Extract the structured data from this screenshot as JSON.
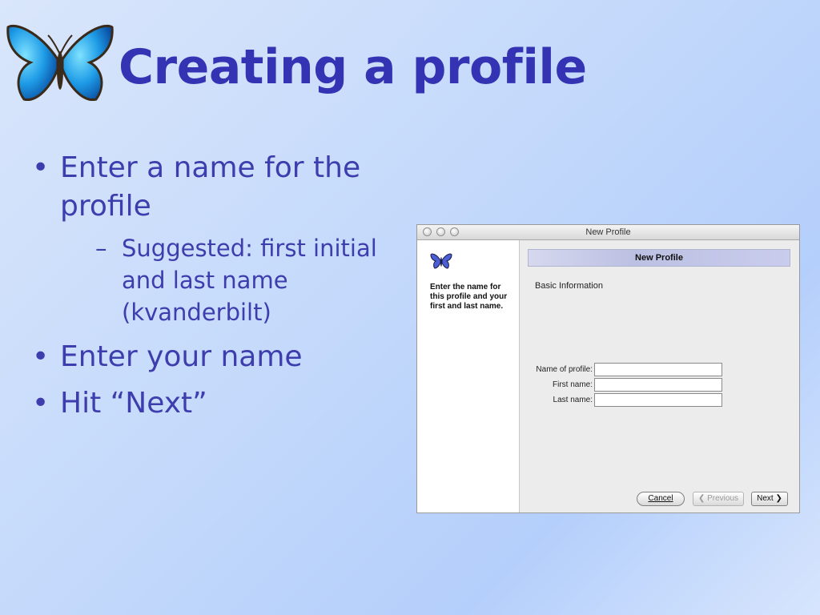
{
  "slide": {
    "title": "Creating a profile",
    "bullets": [
      {
        "text": "Enter a name for the profile",
        "sub": [
          "Suggested: first initial and last name (kvanderbilt)"
        ]
      },
      {
        "text": "Enter your name"
      },
      {
        "text": "Hit “Next”"
      }
    ],
    "icons": {
      "butterfly": "butterfly-icon"
    },
    "colors": {
      "title": "#3333b3",
      "text": "#3d3dae"
    }
  },
  "dialog": {
    "window_title": "New Profile",
    "left_pane_text": "Enter the name for this profile and your first and last name.",
    "header": "New Profile",
    "section": "Basic Information",
    "fields": [
      {
        "label": "Name of profile:",
        "value": ""
      },
      {
        "label": "First name:",
        "value": ""
      },
      {
        "label": "Last name:",
        "value": ""
      }
    ],
    "buttons": {
      "cancel": "Cancel",
      "previous": "Previous",
      "next": "Next"
    },
    "icons": {
      "previous": "chevron-left-icon",
      "next": "chevron-right-icon",
      "logo": "butterfly-icon"
    }
  }
}
